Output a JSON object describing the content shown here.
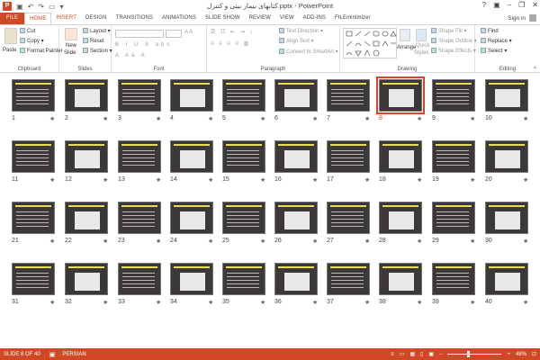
{
  "window": {
    "title": "کتابهای بیمار بینی و کنترل.pptx - PowerPoint"
  },
  "tabs": [
    "FILE",
    "HOME",
    "INSERT",
    "DESIGN",
    "TRANSITIONS",
    "ANIMATIONS",
    "SLIDE SHOW",
    "REVIEW",
    "VIEW",
    "ADD-INS",
    "FILEminimizer"
  ],
  "account": {
    "signin": "Sign in"
  },
  "clipboard": {
    "paste": "Paste",
    "cut": "Cut",
    "copy": "Copy",
    "format_painter": "Format Painter",
    "label": "Clipboard"
  },
  "slides": {
    "new_slide_1": "New",
    "new_slide_2": "Slide",
    "layout": "Layout",
    "reset": "Reset",
    "section": "Section",
    "label": "Slides"
  },
  "font": {
    "label": "Font"
  },
  "paragraph": {
    "text_direction": "Text Direction",
    "align_text": "Align Text",
    "convert_smartart": "Convert to SmartArt",
    "label": "Paragraph"
  },
  "drawing": {
    "arrange": "Arrange",
    "quick_styles_1": "Quick",
    "quick_styles_2": "Styles",
    "shape_fill": "Shape Fill",
    "shape_outline": "Shape Outline",
    "shape_effects": "Shape Effects",
    "label": "Drawing"
  },
  "editing": {
    "find": "Find",
    "replace": "Replace",
    "select": "Select",
    "label": "Editing"
  },
  "sorter": {
    "selected": 8,
    "slides": [
      {
        "n": "1"
      },
      {
        "n": "2"
      },
      {
        "n": "3"
      },
      {
        "n": "4"
      },
      {
        "n": "5"
      },
      {
        "n": "6"
      },
      {
        "n": "7"
      },
      {
        "n": "8"
      },
      {
        "n": "9"
      },
      {
        "n": "10"
      },
      {
        "n": "11"
      },
      {
        "n": "12"
      },
      {
        "n": "13"
      },
      {
        "n": "14"
      },
      {
        "n": "15"
      },
      {
        "n": "16"
      },
      {
        "n": "17"
      },
      {
        "n": "18"
      },
      {
        "n": "19"
      },
      {
        "n": "20"
      },
      {
        "n": "21"
      },
      {
        "n": "22"
      },
      {
        "n": "23"
      },
      {
        "n": "24"
      },
      {
        "n": "25"
      },
      {
        "n": "26"
      },
      {
        "n": "27"
      },
      {
        "n": "28"
      },
      {
        "n": "29"
      },
      {
        "n": "30"
      },
      {
        "n": "31"
      },
      {
        "n": "32"
      },
      {
        "n": "33"
      },
      {
        "n": "34"
      },
      {
        "n": "35"
      },
      {
        "n": "36"
      },
      {
        "n": "37"
      },
      {
        "n": "38"
      },
      {
        "n": "39"
      },
      {
        "n": "40"
      }
    ],
    "star": "★"
  },
  "status": {
    "slide_of": "SLIDE 8 OF 40",
    "language": "PERSIAN",
    "zoom": "48%"
  },
  "colors": {
    "accent": "#d24726",
    "slide_bg": "#3b3837",
    "title_yellow": "#e9dd58"
  }
}
